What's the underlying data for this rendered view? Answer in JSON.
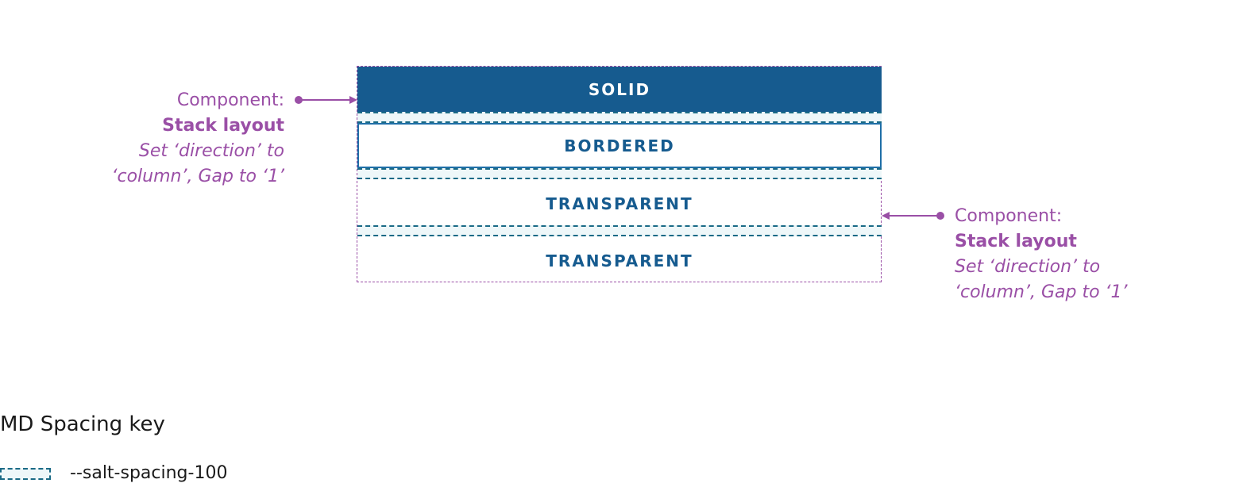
{
  "stack": {
    "buttons": [
      {
        "label": "SOLID",
        "variant": "solid"
      },
      {
        "label": "BORDERED",
        "variant": "bordered"
      },
      {
        "label": "TRANSPARENT",
        "variant": "transparent"
      },
      {
        "label": "TRANSPARENT",
        "variant": "transparent"
      }
    ]
  },
  "annotations": {
    "left": {
      "line1": "Component:",
      "line2": "Stack layout",
      "line3": "Set ‘direction’ to",
      "line4": "‘column’, Gap to ‘1’"
    },
    "right": {
      "line1": "Component:",
      "line2": "Stack layout",
      "line3": "Set ‘direction’ to",
      "line4": "‘column’, Gap to ‘1’"
    }
  },
  "key": {
    "title": "MD Spacing key",
    "items": [
      {
        "label": "--salt-spacing-100"
      }
    ]
  },
  "colors": {
    "primary": "#165b8f",
    "annotation": "#9a4fa6",
    "spacing": "#1a6a86",
    "spacing_fill": "#eef7f9"
  }
}
